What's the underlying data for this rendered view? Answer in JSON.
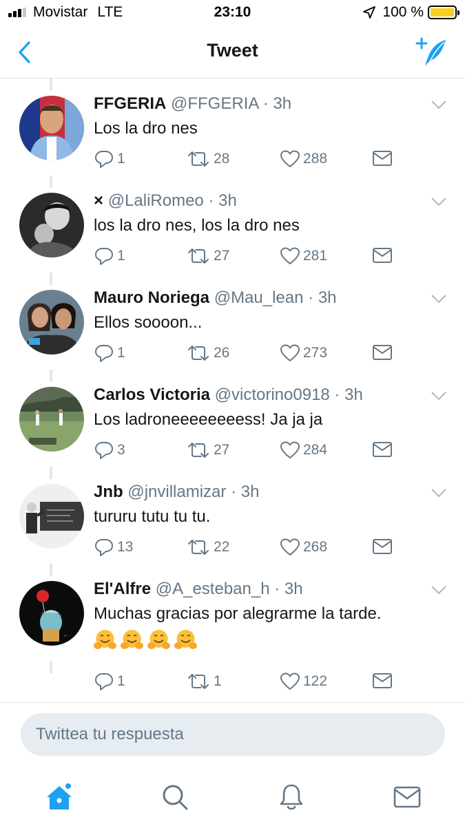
{
  "status_bar": {
    "carrier": "Movistar",
    "network": "LTE",
    "time": "23:10",
    "battery": "100 %",
    "battery_level": 1.0,
    "signal_bars_on": 3,
    "signal_bars_total": 4
  },
  "nav": {
    "title": "Tweet",
    "back_icon": "chevron-left-icon",
    "compose_icon": "compose-tweet-icon"
  },
  "colors": {
    "brand": "#1da1f2",
    "text": "#14171a",
    "secondary": "#657786",
    "divider": "#e1e8ed",
    "battery": "#f8d11c"
  },
  "tweets": [
    {
      "name": "FFGERIA",
      "handle": "@FFGERIA",
      "time": "3h",
      "text": "Los la dro nes",
      "replies": "1",
      "retweets": "28",
      "likes": "288"
    },
    {
      "name": "",
      "prefix": "×",
      "handle": "@LaliRomeo",
      "time": "3h",
      "text": "los la dro nes, los la dro nes",
      "replies": "1",
      "retweets": "27",
      "likes": "281"
    },
    {
      "name": "Mauro Noriega",
      "handle": "@Mau_lean",
      "time": "3h",
      "text": "Ellos soooon...",
      "replies": "1",
      "retweets": "26",
      "likes": "273"
    },
    {
      "name": "Carlos Victoria",
      "handle": "@victorino0918",
      "time": "3h",
      "text": "Los ladroneeeeeeeess! Ja ja ja",
      "replies": "3",
      "retweets": "27",
      "likes": "284"
    },
    {
      "name": "Jnb",
      "handle": "@jnvillamizar",
      "time": "3h",
      "text": "tururu tutu tu tu.",
      "replies": "13",
      "retweets": "22",
      "likes": "268"
    },
    {
      "name": "El'Alfre",
      "handle": "@A_esteban_h",
      "time": "3h",
      "text": "Muchas gracias por alegrarme la tarde.",
      "emoji_count": 4,
      "replies": "1",
      "retweets": "1",
      "likes": "122"
    }
  ],
  "reply": {
    "placeholder": "Twittea tu respuesta"
  },
  "tab_bar": {
    "items": [
      "home-icon",
      "search-icon",
      "notifications-bell-icon",
      "messages-envelope-icon"
    ],
    "active": "home-icon"
  }
}
